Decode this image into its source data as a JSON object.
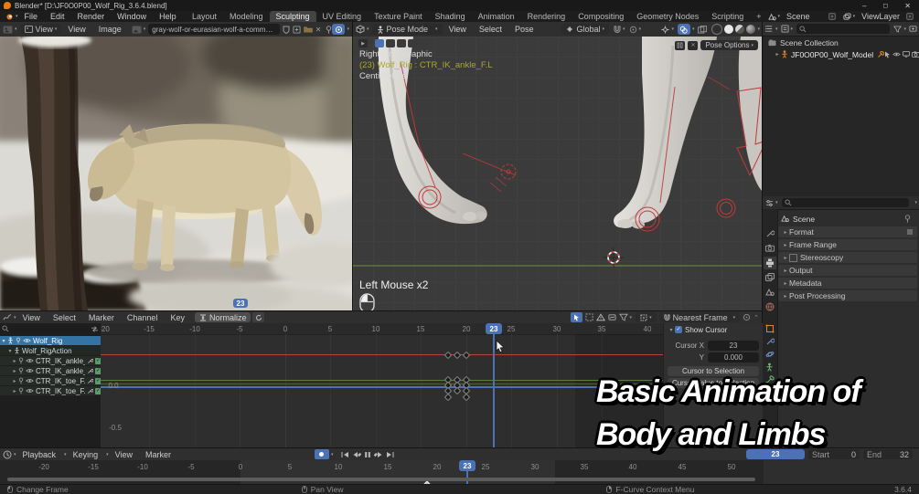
{
  "window": {
    "title": "Blender* [D:\\JF0O0P00_Wolf_Rig_3.6.4.blend]",
    "minimize": "–",
    "maximize": "◻",
    "close": "✕"
  },
  "topbar": {
    "menus": [
      {
        "label": "File"
      },
      {
        "label": "Edit"
      },
      {
        "label": "Render"
      },
      {
        "label": "Window"
      },
      {
        "label": "Help"
      }
    ],
    "workspaces": [
      {
        "label": "Layout"
      },
      {
        "label": "Modeling"
      },
      {
        "label": "Sculpting"
      },
      {
        "label": "UV Editing"
      },
      {
        "label": "Texture Paint"
      },
      {
        "label": "Shading"
      },
      {
        "label": "Animation"
      },
      {
        "label": "Rendering"
      },
      {
        "label": "Compositing"
      },
      {
        "label": "Geometry Nodes"
      },
      {
        "label": "Scripting"
      },
      {
        "label": "+"
      }
    ],
    "scene_selector": {
      "label": "Scene"
    },
    "view_layer_selector": {
      "label": "ViewLayer"
    }
  },
  "image_editor": {
    "mode": "View",
    "menus": [
      {
        "label": "View"
      },
      {
        "label": "Image"
      }
    ],
    "image_name": "gray-wolf-or-eurasian-wolf-a-common-predator-on-the-territory-o",
    "frame_badge": "23"
  },
  "viewport": {
    "mode": "Pose Mode",
    "menus": [
      {
        "label": "View"
      },
      {
        "label": "Select"
      },
      {
        "label": "Pose"
      }
    ],
    "orientation": "Global",
    "pose_options_label": "Pose Options",
    "view_name": "Right Orthographic",
    "active_item": "(23) Wolf_Rig : CTR_IK_ankle_F.L",
    "units": "Centimeters",
    "screencast_label": "Left Mouse x2"
  },
  "outliner": {
    "scene_collection": "Scene Collection",
    "object_name": "JF0O0P00_Wolf_Model"
  },
  "properties": {
    "breadcrumb": "Scene",
    "panels": [
      {
        "label": "Format"
      },
      {
        "label": "Frame Range"
      },
      {
        "label": "Stereoscopy"
      },
      {
        "label": "Output"
      },
      {
        "label": "Metadata"
      },
      {
        "label": "Post Processing"
      }
    ]
  },
  "graph_editor": {
    "menus": [
      {
        "label": "View"
      },
      {
        "label": "Select"
      },
      {
        "label": "Marker"
      },
      {
        "label": "Channel"
      },
      {
        "label": "Key"
      }
    ],
    "normalize_label": "Normalize",
    "snap_mode": "Nearest Frame",
    "channels": [
      {
        "name": "Wolf_Rig"
      },
      {
        "name": "Wolf_RigAction"
      },
      {
        "name": "CTR_IK_ankle_F.L"
      },
      {
        "name": "CTR_IK_ankle_F.R"
      },
      {
        "name": "CTR_IK_toe_F.L"
      },
      {
        "name": "CTR_IK_toe_F.R"
      }
    ],
    "ruler": [
      "-20",
      "-15",
      "-10",
      "-5",
      "0",
      "5",
      "10",
      "15",
      "20",
      "25",
      "30",
      "35",
      "40"
    ],
    "current_frame": "23",
    "value_labels": [
      "0.0",
      "-0.5"
    ],
    "keyframe_frames": [
      18,
      19,
      20
    ],
    "sidebar": {
      "show_cursor_label": "Show Cursor",
      "cursor_x_label": "Cursor X",
      "cursor_x_value": "23",
      "cursor_y_label": "Y",
      "cursor_y_value": "0.000",
      "to_selection_label": "Cursor to Selection",
      "value_to_selection_label": "Cursor Value to Selection"
    }
  },
  "timeline": {
    "menus": [
      {
        "label": "Playback"
      },
      {
        "label": "Keying"
      },
      {
        "label": "View"
      },
      {
        "label": "Marker"
      }
    ],
    "ruler": [
      "-20",
      "-15",
      "-10",
      "-5",
      "0",
      "5",
      "10",
      "15",
      "20",
      "25",
      "30",
      "35",
      "40",
      "45",
      "50"
    ],
    "current_frame": "23",
    "frame_field": "23",
    "start_label": "Start",
    "start_value": "0",
    "end_label": "End",
    "end_value": "32"
  },
  "status_bar": {
    "left": "Change Frame",
    "middle": "Pan View",
    "right": "F-Curve Context Menu",
    "version": "3.6.4"
  },
  "overlay": {
    "line1": "Basic Animation of",
    "line2": "Body and Limbs"
  },
  "accent_colors": {
    "blender_blue": "#4a72b5",
    "rig_red": "#c23a3a",
    "axis_green": "#6a8f3c",
    "selected_channel": "#3474a4"
  }
}
